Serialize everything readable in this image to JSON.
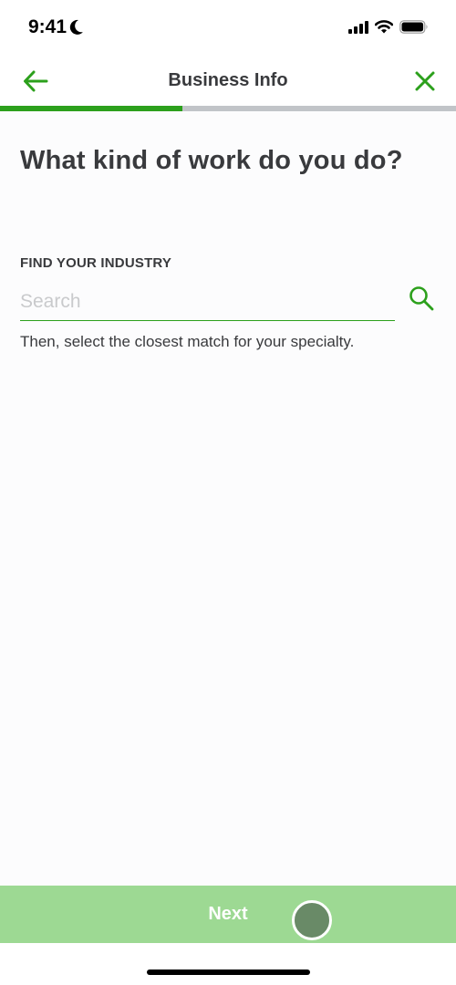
{
  "status_bar": {
    "time": "9:41",
    "icons": [
      "moon-icon",
      "signal-icon",
      "wifi-icon",
      "battery-icon"
    ]
  },
  "nav": {
    "title": "Business Info",
    "back_icon": "arrow-left-icon",
    "close_icon": "close-icon"
  },
  "progress": {
    "fraction": 0.4
  },
  "main": {
    "heading": "What kind of work do you do?",
    "field_label": "FIND YOUR INDUSTRY",
    "search": {
      "value": "",
      "placeholder": "Search",
      "icon": "search-icon"
    },
    "helper_text": "Then, select the closest match for your specialty."
  },
  "footer": {
    "next_label": "Next"
  },
  "colors": {
    "accent": "#2ca01c",
    "button_disabled": "#9dd993",
    "progress_track": "#c1c4c8",
    "text": "#393a3d"
  }
}
